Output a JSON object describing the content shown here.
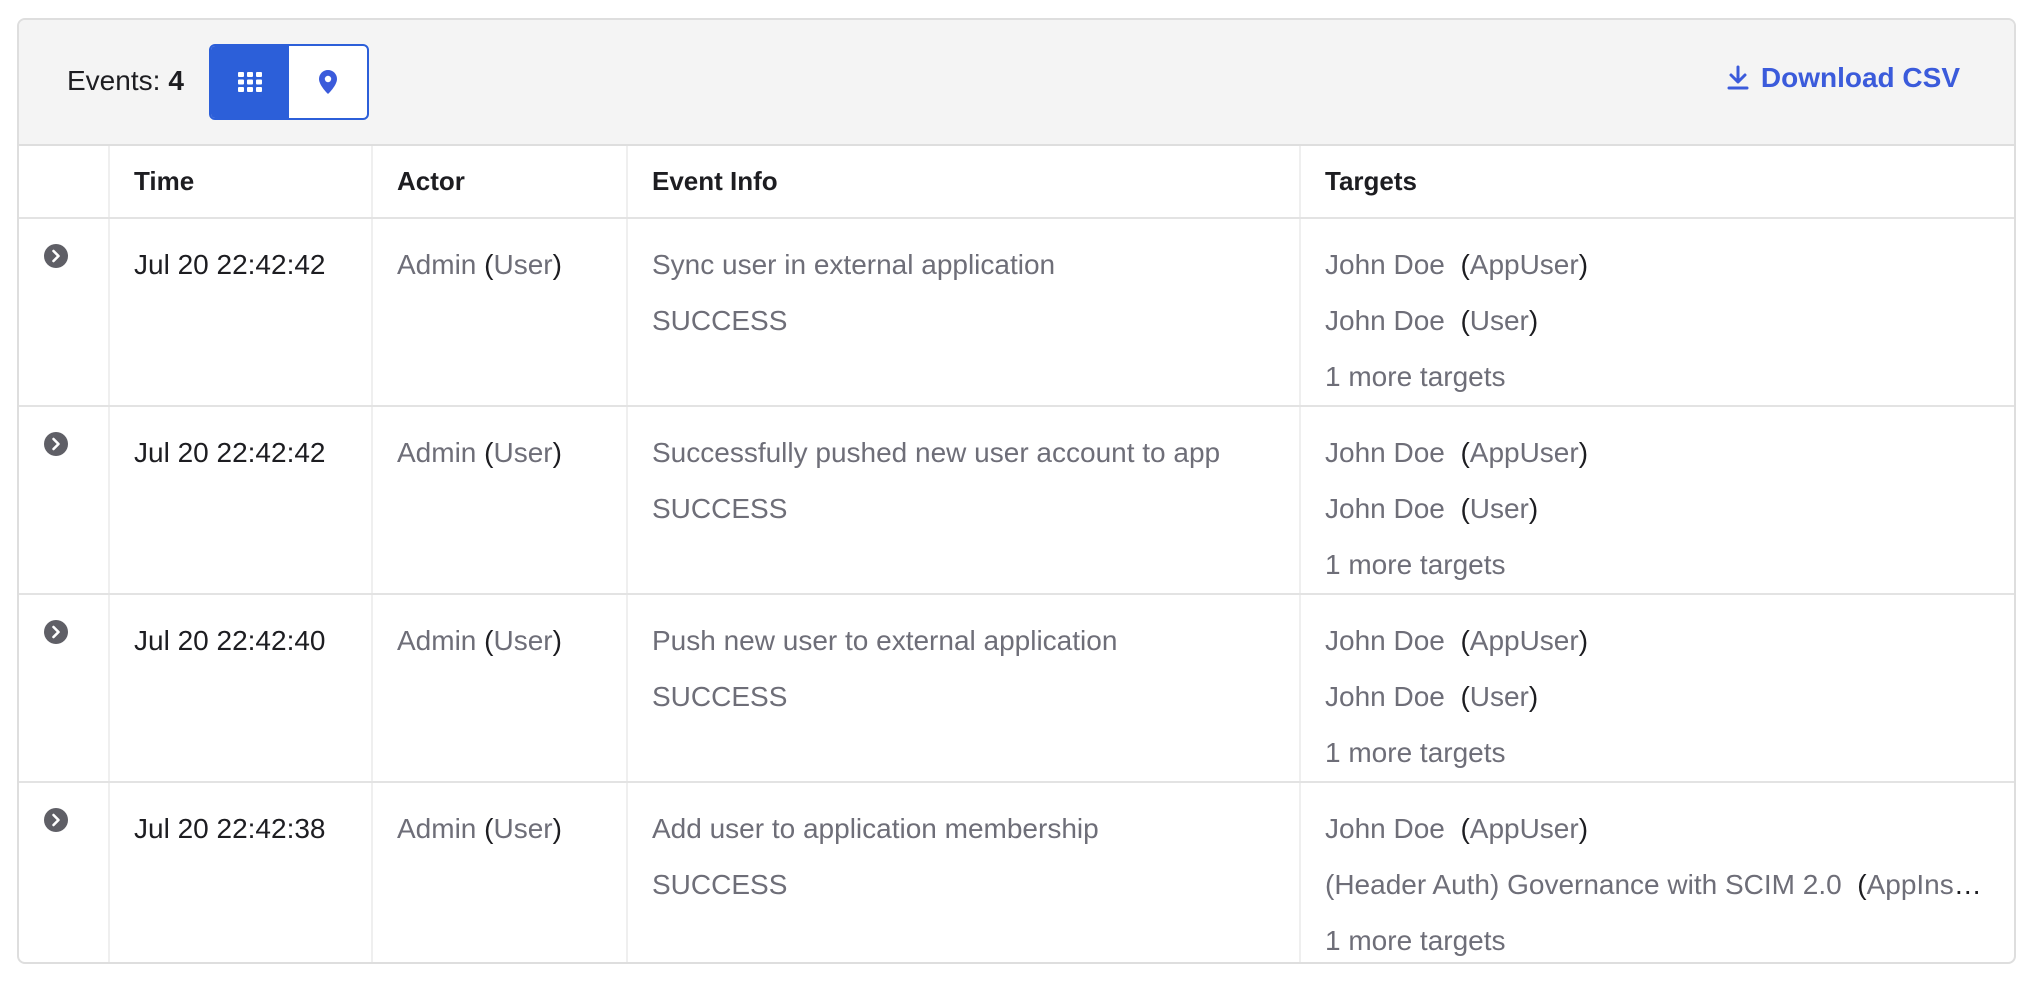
{
  "toolbar": {
    "events_label": "Events:",
    "events_count": "4",
    "grid_view_icon": "grid-icon",
    "map_view_icon": "map-pin-icon",
    "download_label": "Download CSV",
    "download_icon": "download-icon",
    "accent_color": "#2c5fd9",
    "link_color": "#3b5bdb"
  },
  "table": {
    "headers": {
      "time": "Time",
      "actor": "Actor",
      "event_info": "Event Info",
      "targets": "Targets"
    },
    "rows": [
      {
        "time": "Jul 20 22:42:42",
        "actor_name": "Admin",
        "actor_type": "User",
        "event": "Sync user in external application",
        "outcome": "SUCCESS",
        "targets": [
          {
            "name": "John Doe",
            "type": "AppUser"
          },
          {
            "name": "John Doe",
            "type": "User"
          }
        ],
        "more": "1 more targets"
      },
      {
        "time": "Jul 20 22:42:42",
        "actor_name": "Admin",
        "actor_type": "User",
        "event": "Successfully pushed new user account to app",
        "outcome": "SUCCESS",
        "targets": [
          {
            "name": "John Doe",
            "type": "AppUser"
          },
          {
            "name": "John Doe",
            "type": "User"
          }
        ],
        "more": "1 more targets"
      },
      {
        "time": "Jul 20 22:42:40",
        "actor_name": "Admin",
        "actor_type": "User",
        "event": "Push new user to external application",
        "outcome": "SUCCESS",
        "targets": [
          {
            "name": "John Doe",
            "type": "AppUser"
          },
          {
            "name": "John Doe",
            "type": "User"
          }
        ],
        "more": "1 more targets"
      },
      {
        "time": "Jul 20 22:42:38",
        "actor_name": "Admin",
        "actor_type": "User",
        "event": "Add user to application membership",
        "outcome": "SUCCESS",
        "targets": [
          {
            "name": "John Doe",
            "type": "AppUser"
          },
          {
            "name": "(Header Auth) Governance with SCIM 2.0",
            "type": "AppInstance"
          }
        ],
        "more": "1 more targets"
      }
    ]
  }
}
